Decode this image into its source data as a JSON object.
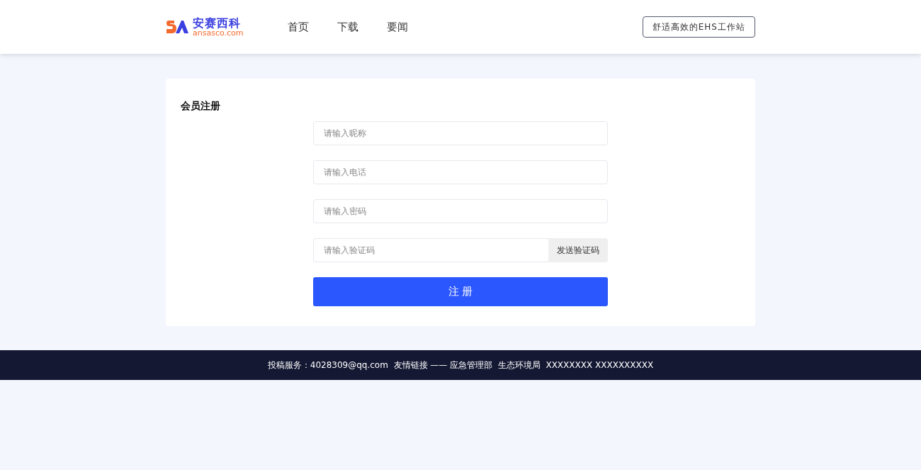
{
  "header": {
    "logo": {
      "name": "安赛西科",
      "domain": "ansasco.com"
    },
    "nav": [
      {
        "label": "首页"
      },
      {
        "label": "下载"
      },
      {
        "label": "要闻"
      }
    ],
    "slogan_button": "舒适高效的EHS工作站"
  },
  "form": {
    "title": "会员注册",
    "fields": [
      {
        "kind": "text",
        "placeholder": "请输入昵称"
      },
      {
        "kind": "text",
        "placeholder": "请输入电话"
      },
      {
        "kind": "password",
        "placeholder": "请输入密码"
      },
      {
        "kind": "code",
        "placeholder": "请输入验证码",
        "button": "发送验证码"
      }
    ],
    "submit": "注 册"
  },
  "footer": {
    "text": "投稿服务：4028309@qq.com  友情链接 —— 应急管理部  生态环境局  XXXXXXXX XXXXXXXXXX"
  }
}
